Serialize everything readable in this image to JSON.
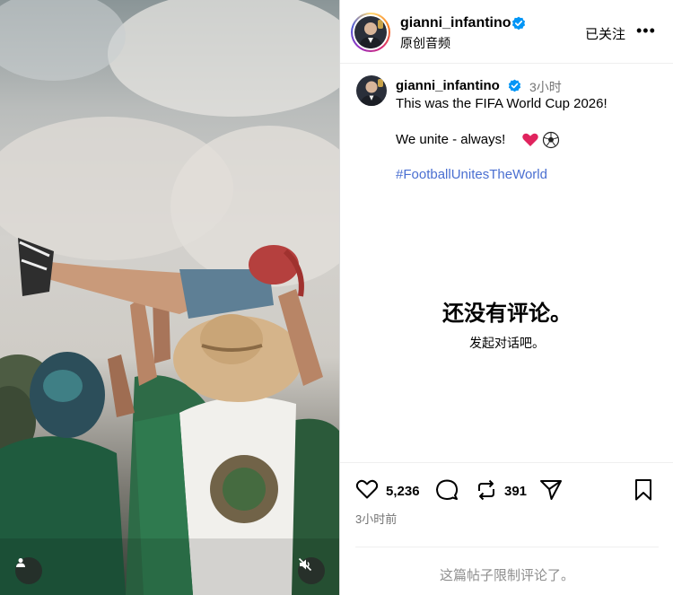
{
  "header": {
    "username": "gianni_infantino",
    "audio_label": "原创音频",
    "follow_label": "已关注",
    "more_label": "•••"
  },
  "caption": {
    "username": "gianni_infantino",
    "time": "3小时",
    "line1": "This was the FIFA World Cup 2026!",
    "line2": "We unite - always!",
    "hashtag": "#FootballUnitesTheWorld"
  },
  "comments": {
    "empty_title": "还没有评论。",
    "empty_subtitle": "发起对话吧。",
    "limited_notice": "这篇帖子限制评论了。"
  },
  "actions": {
    "likes": "5,236",
    "reposts": "391",
    "date": "3小时前"
  },
  "icons": {
    "verified": "verified-badge-icon",
    "like": "heart-outline-icon",
    "comment": "speech-bubble-icon",
    "repost": "repost-arrows-icon",
    "share": "paper-plane-icon",
    "save": "bookmark-icon",
    "user_tag": "user-icon",
    "mute": "speaker-muted-icon"
  },
  "colors": {
    "verified_blue": "#0095f6",
    "hashtag_blue": "#4a6fd1",
    "secondary_text": "#737373",
    "heart_red": "#e0245e"
  }
}
